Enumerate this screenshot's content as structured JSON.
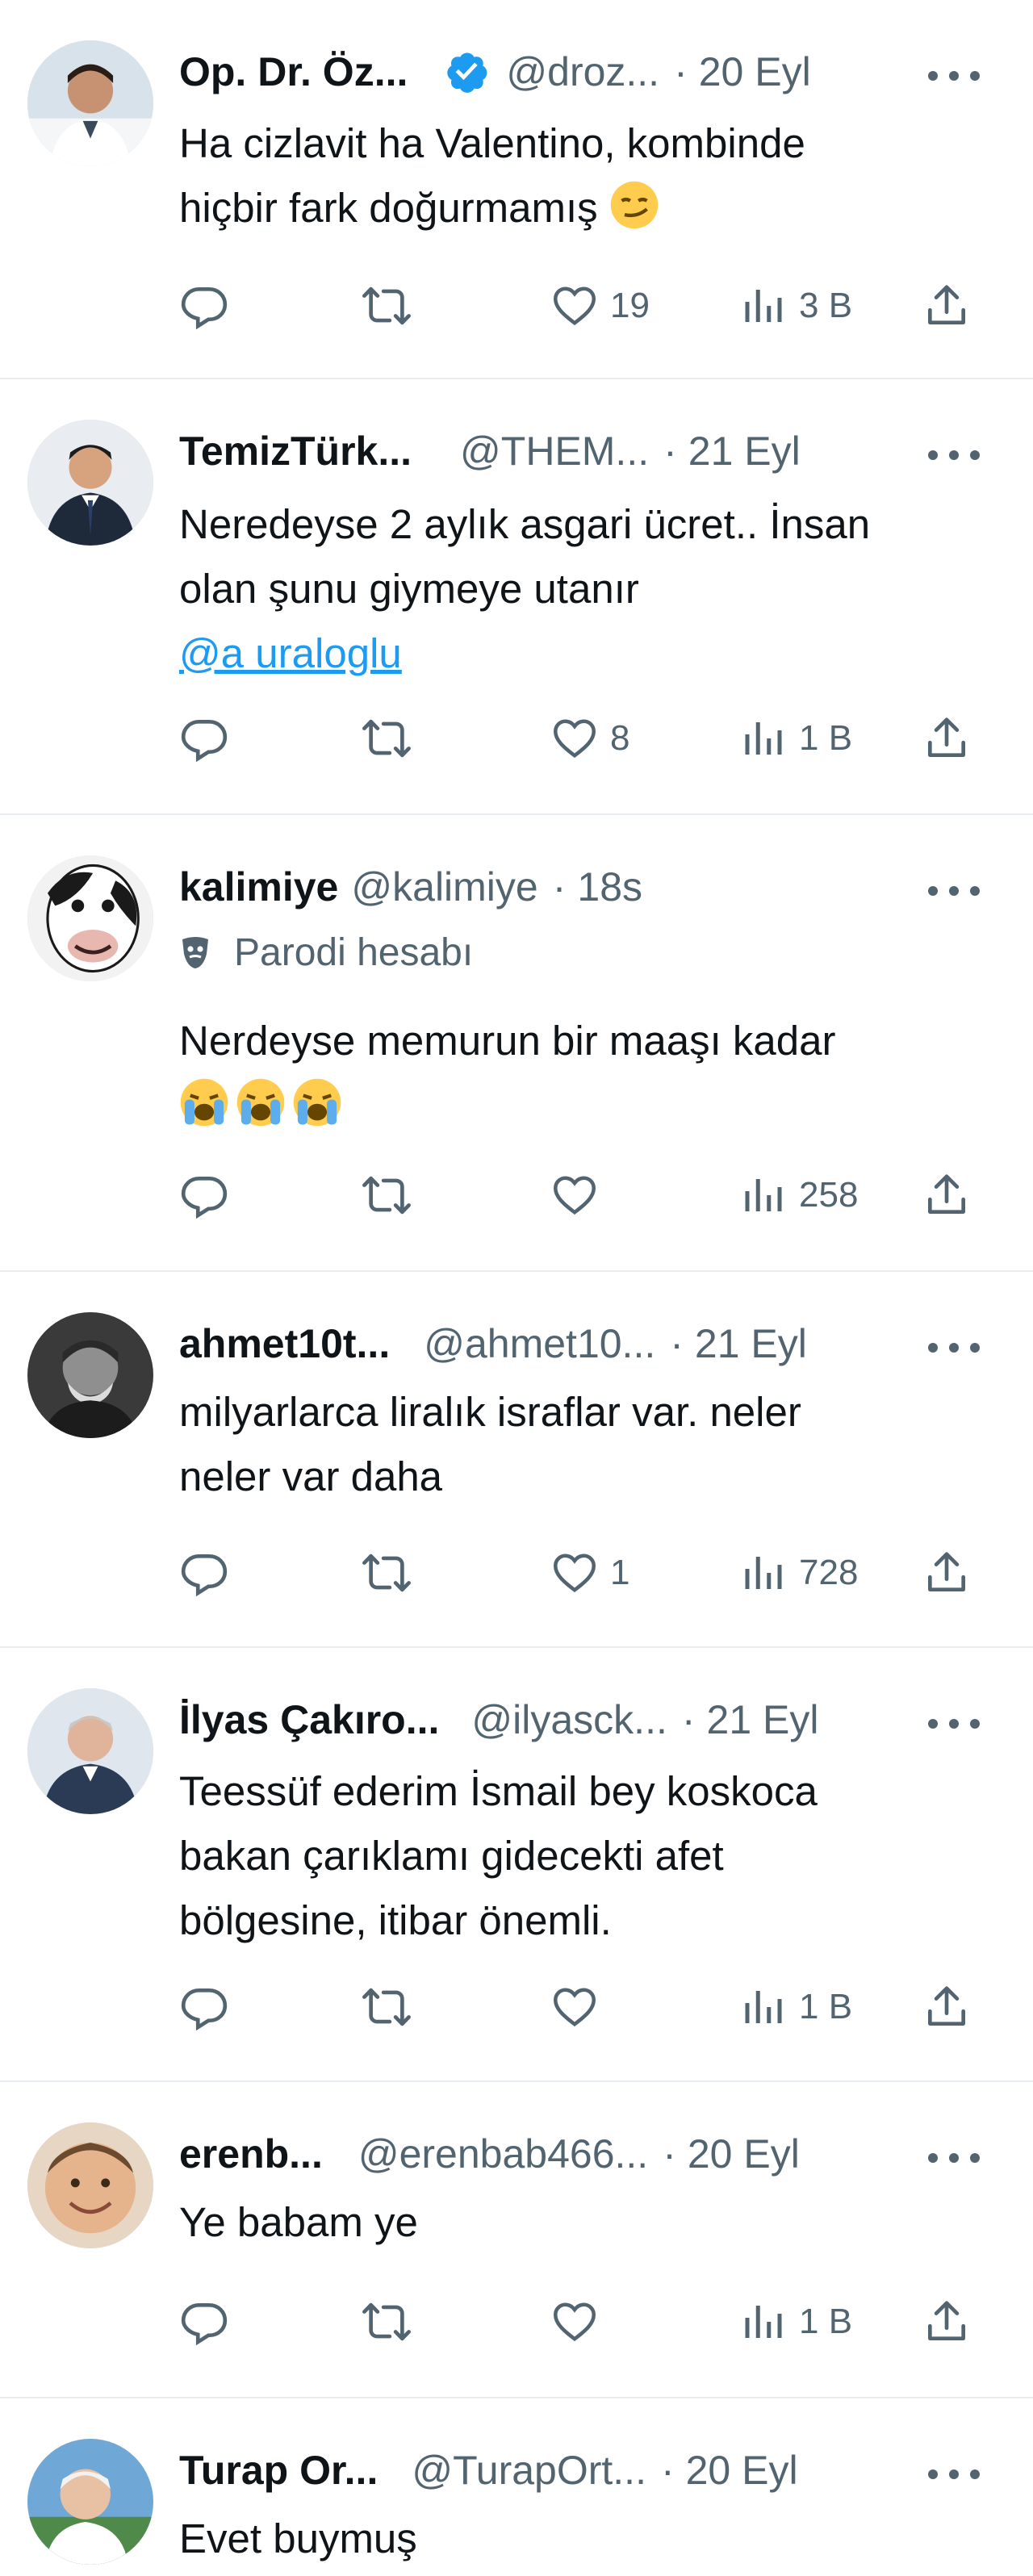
{
  "colors": {
    "text": "#0f1419",
    "muted": "#536471",
    "link": "#1d9bf0",
    "verified": "#1d9bf0",
    "divider": "#e6ecf0"
  },
  "tweets": [
    {
      "name": "Op. Dr. Öz...",
      "verified": true,
      "handle": "@droz...",
      "time": "20 Eyl",
      "lines": [
        "Ha cizlavit ha Valentino, kombinde",
        "hiçbir fark doğurmamış"
      ],
      "emoji": "smirk-face",
      "likes": "19",
      "views": "3 B"
    },
    {
      "name": "TemizTürk...",
      "handle": "@THEM...",
      "time": "21 Eyl",
      "lines": [
        "Neredeyse 2 aylık asgari ücret.. İnsan",
        "olan şunu giymeye utanır"
      ],
      "link": "@a uraloglu",
      "likes": "8",
      "views": "1 B"
    },
    {
      "name": "kalimiye",
      "handle": "@kalimiye",
      "time": "18s",
      "parody": "Parodi hesabı",
      "lines": [
        "Nerdeyse memurun bir maaşı kadar"
      ],
      "emoji": "loudly-crying-face x3",
      "views": "258"
    },
    {
      "name": "ahmet10t...",
      "handle": "@ahmet10...",
      "time": "21 Eyl",
      "lines": [
        "milyarlarca liralık israflar var. neler",
        "neler var daha"
      ],
      "likes": "1",
      "views": "728"
    },
    {
      "name": "İlyas Çakıro...",
      "handle": "@ilyasck...",
      "time": "21 Eyl",
      "lines": [
        "Teessüf ederim İsmail bey koskoca",
        "bakan çarıklamı gidecekti afet",
        "bölgesine, itibar önemli."
      ],
      "views": "1 B"
    },
    {
      "name": "erenb...",
      "handle": "@erenbab466...",
      "time": "20 Eyl",
      "lines": [
        "Ye babam ye"
      ],
      "views": "1 B"
    },
    {
      "name": "Turap Or...",
      "handle": "@TurapOrt...",
      "time": "20 Eyl",
      "lines": [
        "Evet buymuş"
      ]
    }
  ]
}
